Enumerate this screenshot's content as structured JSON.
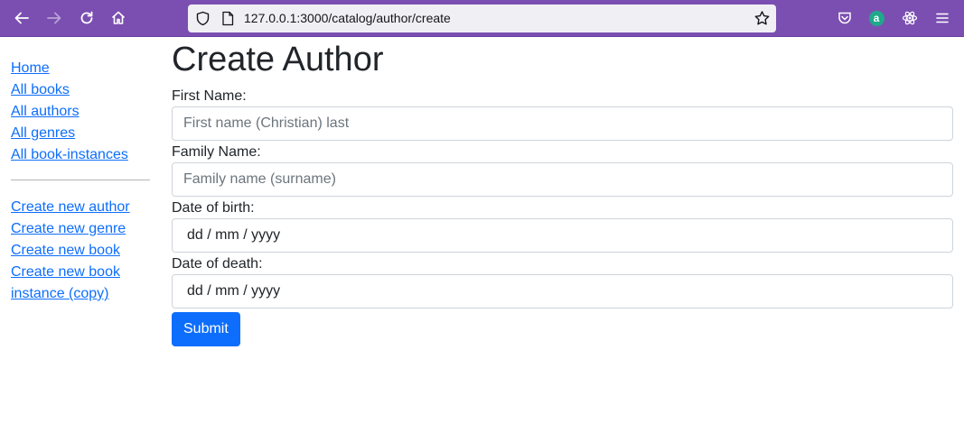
{
  "browser": {
    "url": "127.0.0.1:3000/catalog/author/create",
    "accent_color": "#7b4fb1",
    "icons": [
      "back-icon",
      "forward-icon",
      "reload-icon",
      "home-icon",
      "shield-icon",
      "page-icon",
      "bookmark-star-icon",
      "pocket-icon",
      "extension-a-icon",
      "react-devtools-icon",
      "menu-icon"
    ],
    "extension_letter": "a"
  },
  "sidebar": {
    "nav": [
      {
        "label": "Home"
      },
      {
        "label": "All books"
      },
      {
        "label": "All authors"
      },
      {
        "label": "All genres"
      },
      {
        "label": "All book-instances"
      }
    ],
    "create": [
      {
        "label": "Create new author"
      },
      {
        "label": "Create new genre"
      },
      {
        "label": "Create new book"
      },
      {
        "label": "Create new book instance (copy)"
      }
    ],
    "link_color": "#0d6efd"
  },
  "main": {
    "title": "Create Author",
    "first_name": {
      "label": "First Name:",
      "placeholder": "First name (Christian) last",
      "value": ""
    },
    "family_name": {
      "label": "Family Name:",
      "placeholder": "Family name (surname)",
      "value": ""
    },
    "birth": {
      "label": "Date of birth:",
      "value": "dd / mm / yyyy"
    },
    "death": {
      "label": "Date of death:",
      "value": "dd / mm / yyyy"
    },
    "submit_label": "Submit",
    "button_color": "#0d6efd"
  }
}
